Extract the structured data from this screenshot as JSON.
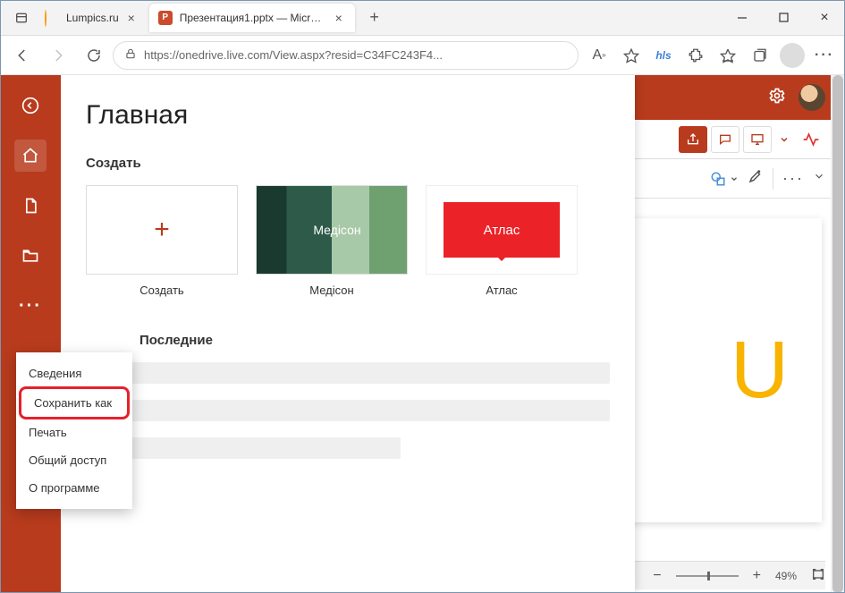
{
  "browser": {
    "tabs": [
      {
        "title": "Lumpics.ru",
        "active": false
      },
      {
        "title": "Презентация1.pptx — Microsoft",
        "active": true
      }
    ],
    "url": "https://onedrive.live.com/View.aspx?resid=C34FC243F4...",
    "extension_label": "hls"
  },
  "backstage": {
    "page_title": "Главная",
    "create_section": "Создать",
    "recent_section": "Последние",
    "templates": [
      {
        "key": "new",
        "caption": "Создать"
      },
      {
        "key": "madison",
        "caption": "Медісон",
        "thumb_text": "Медісон"
      },
      {
        "key": "atlas",
        "caption": "Атлас",
        "thumb_text": "Атлас"
      }
    ],
    "overflow_menu": [
      "Сведения",
      "Сохранить как",
      "Печать",
      "Общий доступ",
      "О программе"
    ]
  },
  "pp_right": {
    "canvas_letter": "U",
    "zoom_percent": "49%"
  }
}
